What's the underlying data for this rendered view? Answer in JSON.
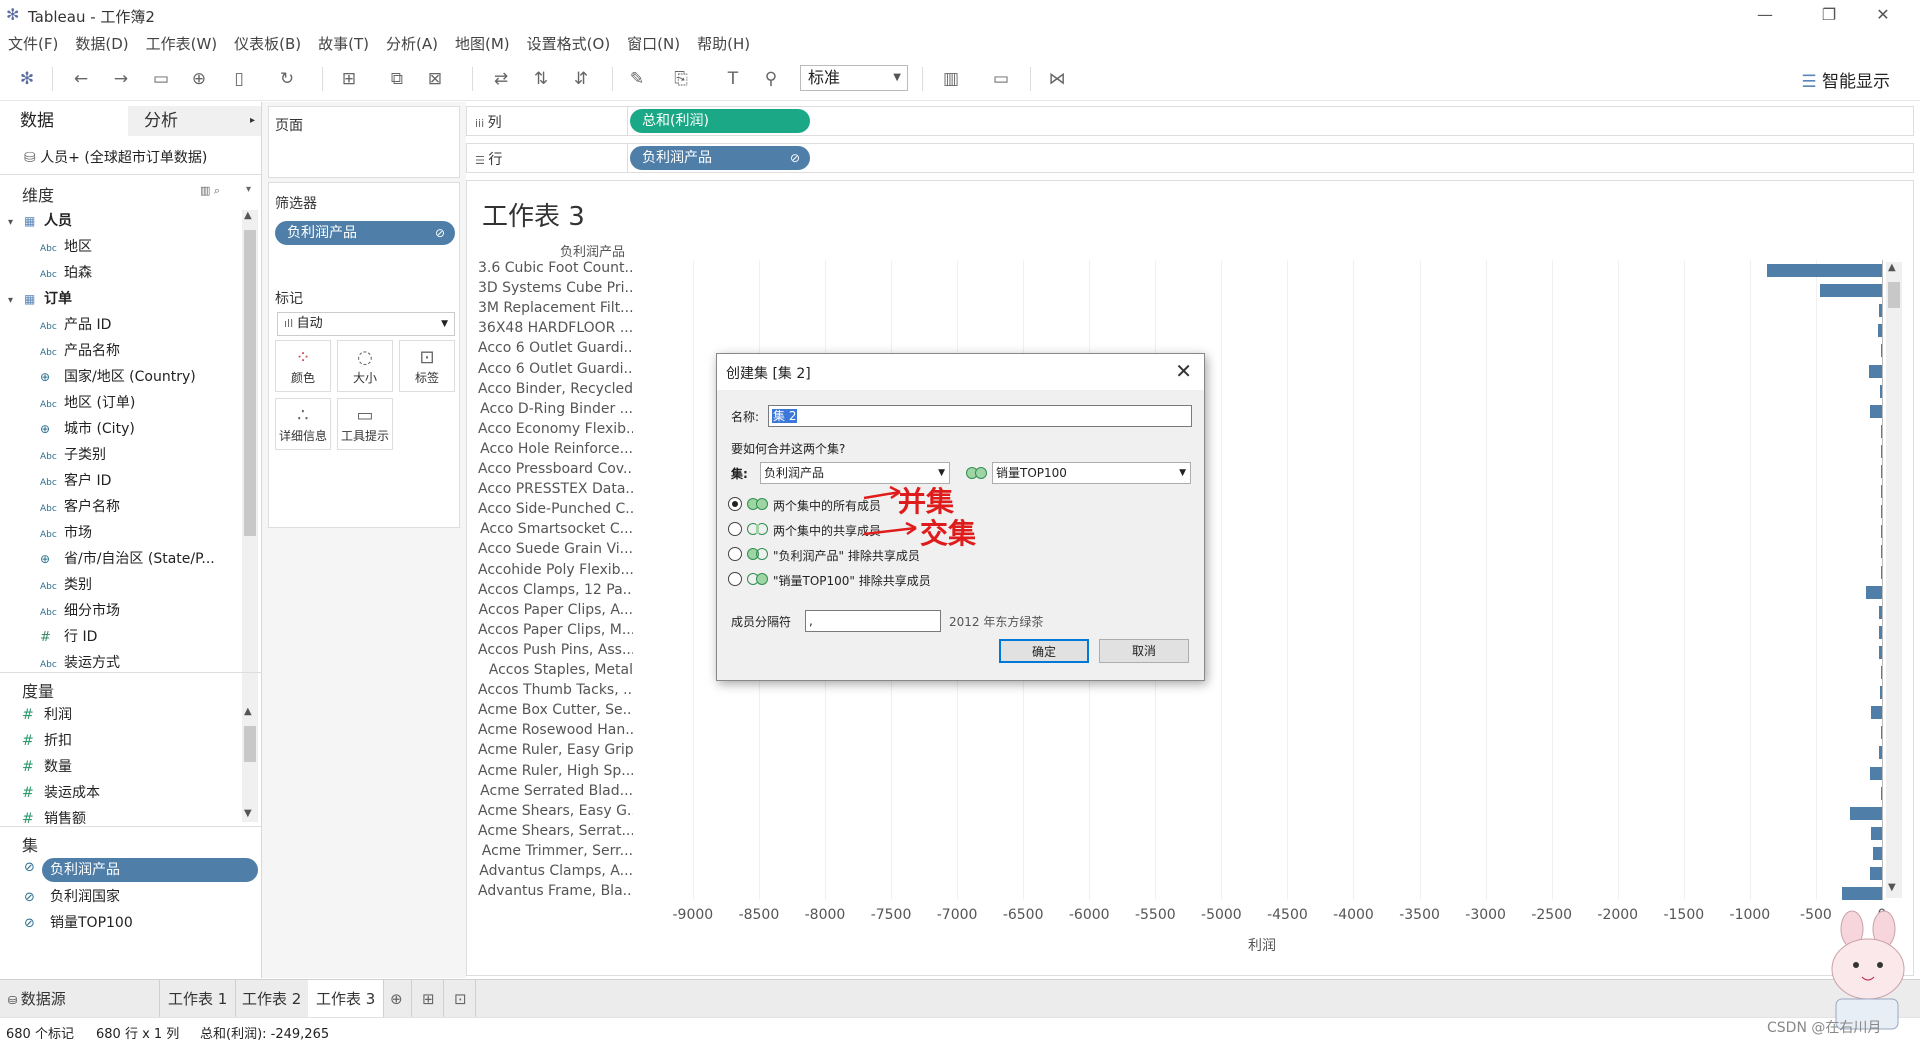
{
  "window": {
    "title": "Tableau - 工作簿2",
    "minimize": "—",
    "restore": "❐",
    "close": "✕"
  },
  "menu": [
    "文件(F)",
    "数据(D)",
    "工作表(W)",
    "仪表板(B)",
    "故事(T)",
    "分析(A)",
    "地图(M)",
    "设置格式(O)",
    "窗口(N)",
    "帮助(H)"
  ],
  "toolbar": {
    "fit_value": "标准",
    "show_me": "智能显示"
  },
  "left_pane": {
    "tab_data": "数据",
    "tab_analysis": "分析",
    "datasource": "人员+ (全球超市订单数据)",
    "dimensions_label": "维度",
    "groups": [
      {
        "name": "人员",
        "fields": [
          {
            "icon": "Abc",
            "name": "地区"
          },
          {
            "icon": "Abc",
            "name": "珀森"
          }
        ]
      },
      {
        "name": "订单",
        "fields": [
          {
            "icon": "Abc",
            "name": "产品 ID"
          },
          {
            "icon": "Abc",
            "name": "产品名称"
          },
          {
            "icon": "globe",
            "name": "国家/地区 (Country)"
          },
          {
            "icon": "Abc",
            "name": "地区 (订单)"
          },
          {
            "icon": "globe",
            "name": "城市 (City)"
          },
          {
            "icon": "Abc",
            "name": "子类别"
          },
          {
            "icon": "Abc",
            "name": "客户 ID"
          },
          {
            "icon": "Abc",
            "name": "客户名称"
          },
          {
            "icon": "Abc",
            "name": "市场"
          },
          {
            "icon": "globe",
            "name": "省/市/自治区 (State/P..."
          },
          {
            "icon": "Abc",
            "name": "类别"
          },
          {
            "icon": "Abc",
            "name": "细分市场"
          },
          {
            "icon": "#",
            "name": "行 ID"
          },
          {
            "icon": "Abc",
            "name": "装运方式"
          }
        ]
      }
    ],
    "measures_label": "度量",
    "measures": [
      "利润",
      "折扣",
      "数量",
      "装运成本",
      "销售额"
    ],
    "sets_label": "集",
    "sets": [
      "负利润产品",
      "负利润国家",
      "销量TOP100"
    ]
  },
  "shelves": {
    "pages_label": "页面",
    "filters_label": "筛选器",
    "filter_pill": "负利润产品",
    "marks_label": "标记",
    "marks_type": "自动",
    "mark_buttons": [
      "颜色",
      "大小",
      "标签",
      "详细信息",
      "工具提示"
    ],
    "columns_label": "列",
    "columns_pill": "总和(利润)",
    "rows_label": "行",
    "rows_pill": "负利润产品"
  },
  "worksheet": {
    "title": "工作表 3",
    "row_field": "负利润产品",
    "x_label": "利润"
  },
  "chart_data": {
    "type": "bar",
    "orientation": "horizontal",
    "title": "工作表 3",
    "xlabel": "利润",
    "ylabel": "负利润产品",
    "xlim": [
      -9400,
      0
    ],
    "x_ticks": [
      "-9000",
      "-8500",
      "-8000",
      "-7500",
      "-7000",
      "-6500",
      "-6000",
      "-5500",
      "-5000",
      "-4500",
      "-4000",
      "-3500",
      "-3000",
      "-2500",
      "-2000",
      "-1500",
      "-1000",
      "-500",
      "0"
    ],
    "categories": [
      "3.6 Cubic Foot Count...",
      "3D Systems Cube Pri...",
      "3M Replacement Filt...",
      "36X48 HARDFLOOR ...",
      "Acco 6 Outlet Guardi...",
      "Acco 6 Outlet Guardi...",
      "Acco Binder, Recycled",
      "Acco D-Ring Binder ...",
      "Acco Economy Flexib...",
      "Acco Hole Reinforce...",
      "Acco Pressboard Cov...",
      "Acco PRESSTEX Data...",
      "Acco Side-Punched C...",
      "Acco Smartsocket C...",
      "Acco Suede Grain Vi...",
      "Accohide Poly Flexib...",
      "Accos Clamps, 12 Pa...",
      "Accos Paper Clips, A...",
      "Accos Paper Clips, M...",
      "Accos Push Pins, Ass...",
      "Accos Staples, Metal",
      "Accos Thumb Tacks, ...",
      "Acme Box Cutter, Se...",
      "Acme Rosewood Han...",
      "Acme Ruler, Easy Grip",
      "Acme Ruler, High Sp...",
      "Acme Serrated Blad...",
      "Acme Shears, Easy G...",
      "Acme Shears, Serrat...",
      "Acme Trimmer, Serr...",
      "Advantus Clamps, A...",
      "Advantus Frame, Bla..."
    ],
    "values": [
      -870,
      -470,
      -20,
      -30,
      -5,
      -100,
      -15,
      -90,
      -10,
      -5,
      -5,
      -5,
      -5,
      -5,
      -5,
      -5,
      -120,
      -20,
      -25,
      -20,
      -10,
      -15,
      -80,
      -5,
      -20,
      -90,
      -5,
      -240,
      -80,
      -70,
      -90,
      -300
    ]
  },
  "dialog": {
    "title": "创建集 [集 2]",
    "name_label": "名称:",
    "name_value": "集 2",
    "combine_question": "要如何合并这两个集?",
    "sets_label": "集:",
    "set_a": "负利润产品",
    "set_b": "销量TOP100",
    "options": [
      "两个集中的所有成员",
      "两个集中的共享成员",
      "\"负利润产品\" 排除共享成员",
      "\"销量TOP100\" 排除共享成员"
    ],
    "separator_label": "成员分隔符",
    "separator_value": ",",
    "separator_example": "2012 年东方绿茶",
    "ok": "确定",
    "cancel": "取消",
    "annotation_union": "并集",
    "annotation_intersect": "交集"
  },
  "bottom_tabs": [
    "数据源",
    "工作表 1",
    "工作表 2",
    "工作表 3"
  ],
  "status": {
    "marks": "680 个标记",
    "rows_cols": "680 行 x 1 列",
    "sum": "总和(利润): -249,265"
  },
  "watermark": "CSDN @在右川月",
  "colors": {
    "bar": "#4f7fa8",
    "measure_pill": "#1aa886",
    "dimension_pill": "#4f7fa8",
    "annotation": "#e01b1b"
  }
}
